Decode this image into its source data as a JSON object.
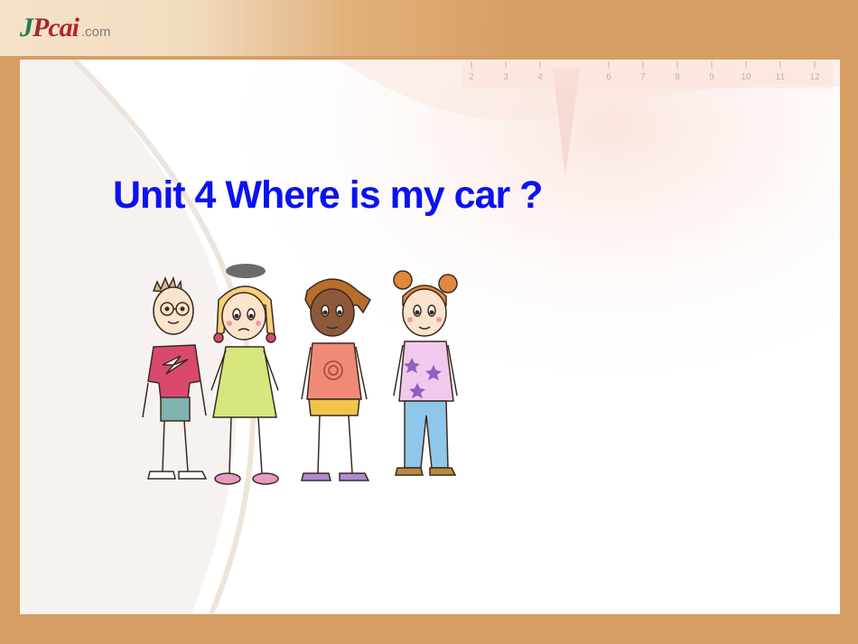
{
  "logo": {
    "mark_j": "J",
    "mark_p": "P",
    "mark_cai": "cai",
    "suffix": ".com"
  },
  "slide": {
    "title": "Unit 4 Where is my car ?"
  },
  "ruler": {
    "ticks": [
      "2",
      "3",
      "4",
      "6",
      "7",
      "8",
      "9",
      "10",
      "11",
      "12"
    ]
  },
  "colors": {
    "frame": "#d69e63",
    "title": "#0b12f0",
    "panel": "#ffffff"
  },
  "illustration": {
    "subject": "four-children-cartoon"
  }
}
